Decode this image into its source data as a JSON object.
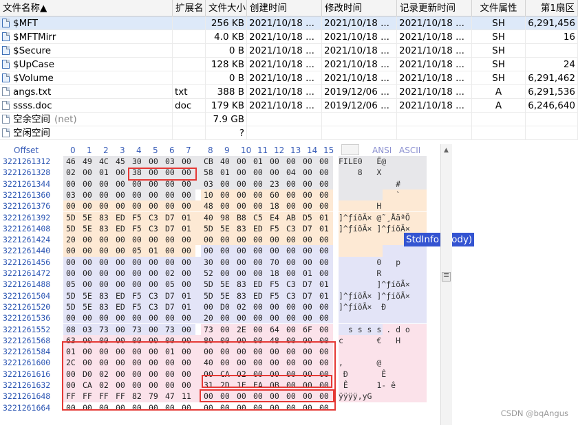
{
  "file_table": {
    "headers": {
      "name": "文件名称▲",
      "ext": "扩展名",
      "size": "文件大小",
      "ctime": "创建时间",
      "mtime": "修改时间",
      "rtime": "记录更新时间",
      "attr": "文件属性",
      "sector": "第1扇区"
    },
    "rows": [
      {
        "name": "$MFT",
        "ext": "",
        "size": "256 KB",
        "ctime": "2021/10/18  ...",
        "mtime": "2021/10/18  ...",
        "rtime": "2021/10/18  ...",
        "attr": "SH",
        "sector": "6,291,456",
        "selected": true
      },
      {
        "name": "$MFTMirr",
        "ext": "",
        "size": "4.0 KB",
        "ctime": "2021/10/18  ...",
        "mtime": "2021/10/18  ...",
        "rtime": "2021/10/18  ...",
        "attr": "SH",
        "sector": "16"
      },
      {
        "name": "$Secure",
        "ext": "",
        "size": "0 B",
        "ctime": "2021/10/18  ...",
        "mtime": "2021/10/18  ...",
        "rtime": "2021/10/18  ...",
        "attr": "SH",
        "sector": ""
      },
      {
        "name": "$UpCase",
        "ext": "",
        "size": "128 KB",
        "ctime": "2021/10/18  ...",
        "mtime": "2021/10/18  ...",
        "rtime": "2021/10/18  ...",
        "attr": "SH",
        "sector": "24"
      },
      {
        "name": "$Volume",
        "ext": "",
        "size": "0 B",
        "ctime": "2021/10/18  ...",
        "mtime": "2021/10/18  ...",
        "rtime": "2021/10/18  ...",
        "attr": "SH",
        "sector": "6,291,462"
      },
      {
        "name": "angs.txt",
        "ext": "txt",
        "size": "388 B",
        "ctime": "2021/10/18  ...",
        "mtime": "2019/12/06  ...",
        "rtime": "2021/10/18  ...",
        "attr": "A",
        "sector": "6,291,536"
      },
      {
        "name": "ssss.doc",
        "ext": "doc",
        "size": "179 KB",
        "ctime": "2021/10/18  ...",
        "mtime": "2019/12/06  ...",
        "rtime": "2021/10/18  ...",
        "attr": "A",
        "sector": "6,246,640"
      },
      {
        "name": "空余空间",
        "name_suffix": "(net)",
        "ext": "",
        "size": "7.9 GB",
        "ctime": "",
        "mtime": "",
        "rtime": "",
        "attr": "",
        "sector": ""
      },
      {
        "name": "空闲空间",
        "ext": "",
        "size": "?",
        "ctime": "",
        "mtime": "",
        "rtime": "",
        "attr": "",
        "sector": ""
      }
    ]
  },
  "hex_view": {
    "offset_label": "Offset",
    "columns": [
      "0",
      "1",
      "2",
      "3",
      "4",
      "5",
      "6",
      "7",
      "8",
      "9",
      "10",
      "11",
      "12",
      "13",
      "14",
      "15"
    ],
    "ansi_label": "ANSI",
    "ascii_label": "ASCII",
    "lines": [
      {
        "offset": "3221261312",
        "bytes": [
          "46",
          "49",
          "4C",
          "45",
          "30",
          "00",
          "03",
          "00",
          "CB",
          "40",
          "00",
          "01",
          "00",
          "00",
          "00",
          "00"
        ],
        "ascii": "FILE0   Ë@"
      },
      {
        "offset": "3221261328",
        "bytes": [
          "02",
          "00",
          "01",
          "00",
          "38",
          "00",
          "00",
          "00",
          "58",
          "01",
          "00",
          "00",
          "00",
          "04",
          "00",
          "00"
        ],
        "ascii": "    8   X"
      },
      {
        "offset": "3221261344",
        "bytes": [
          "00",
          "00",
          "00",
          "00",
          "00",
          "00",
          "00",
          "00",
          "03",
          "00",
          "00",
          "00",
          "23",
          "00",
          "00",
          "00"
        ],
        "ascii": "            #"
      },
      {
        "offset": "3221261360",
        "bytes": [
          "03",
          "00",
          "00",
          "00",
          "00",
          "00",
          "00",
          "00",
          "10",
          "00",
          "00",
          "00",
          "60",
          "00",
          "00",
          "00"
        ],
        "ascii": "            `"
      },
      {
        "offset": "3221261376",
        "bytes": [
          "00",
          "00",
          "00",
          "00",
          "00",
          "00",
          "00",
          "00",
          "48",
          "00",
          "00",
          "00",
          "18",
          "00",
          "00",
          "00"
        ],
        "ascii": "        H"
      },
      {
        "offset": "3221261392",
        "bytes": [
          "5D",
          "5E",
          "83",
          "ED",
          "F5",
          "C3",
          "D7",
          "01",
          "40",
          "98",
          "B8",
          "C5",
          "E4",
          "AB",
          "D5",
          "01"
        ],
        "ascii": "]^ƒíõÃ× @˜¸ÅäªÕ"
      },
      {
        "offset": "3221261408",
        "bytes": [
          "5D",
          "5E",
          "83",
          "ED",
          "F5",
          "C3",
          "D7",
          "01",
          "5D",
          "5E",
          "83",
          "ED",
          "F5",
          "C3",
          "D7",
          "01"
        ],
        "ascii": "]^ƒíõÃ× ]^ƒíõÃ×"
      },
      {
        "offset": "3221261424",
        "bytes": [
          "20",
          "00",
          "00",
          "00",
          "00",
          "00",
          "00",
          "00",
          "00",
          "00",
          "00",
          "00",
          "00",
          "00",
          "00",
          "00"
        ],
        "ascii": ""
      },
      {
        "offset": "3221261440",
        "bytes": [
          "00",
          "00",
          "00",
          "00",
          "05",
          "01",
          "00",
          "00",
          "00",
          "00",
          "00",
          "00",
          "00",
          "00",
          "00",
          "00"
        ],
        "ascii": ""
      },
      {
        "offset": "3221261456",
        "bytes": [
          "00",
          "00",
          "00",
          "00",
          "00",
          "00",
          "00",
          "00",
          "30",
          "00",
          "00",
          "00",
          "70",
          "00",
          "00",
          "00"
        ],
        "ascii": "        0   p"
      },
      {
        "offset": "3221261472",
        "bytes": [
          "00",
          "00",
          "00",
          "00",
          "00",
          "00",
          "02",
          "00",
          "52",
          "00",
          "00",
          "00",
          "18",
          "00",
          "01",
          "00"
        ],
        "ascii": "        R"
      },
      {
        "offset": "3221261488",
        "bytes": [
          "05",
          "00",
          "00",
          "00",
          "00",
          "00",
          "05",
          "00",
          "5D",
          "5E",
          "83",
          "ED",
          "F5",
          "C3",
          "D7",
          "01"
        ],
        "ascii": "        ]^ƒíõÃ×"
      },
      {
        "offset": "3221261504",
        "bytes": [
          "5D",
          "5E",
          "83",
          "ED",
          "F5",
          "C3",
          "D7",
          "01",
          "5D",
          "5E",
          "83",
          "ED",
          "F5",
          "C3",
          "D7",
          "01"
        ],
        "ascii": "]^ƒíõÃ× ]^ƒíõÃ×"
      },
      {
        "offset": "3221261520",
        "bytes": [
          "5D",
          "5E",
          "83",
          "ED",
          "F5",
          "C3",
          "D7",
          "01",
          "00",
          "D0",
          "02",
          "00",
          "00",
          "00",
          "00",
          "00"
        ],
        "ascii": "]^ƒíõÃ×  Ð"
      },
      {
        "offset": "3221261536",
        "bytes": [
          "00",
          "00",
          "00",
          "00",
          "00",
          "00",
          "00",
          "00",
          "20",
          "00",
          "00",
          "00",
          "00",
          "00",
          "00",
          "00"
        ],
        "ascii": ""
      },
      {
        "offset": "3221261552",
        "bytes": [
          "08",
          "03",
          "73",
          "00",
          "73",
          "00",
          "73",
          "00",
          "73",
          "00",
          "2E",
          "00",
          "64",
          "00",
          "6F",
          "00"
        ],
        "ascii": "  s s s s . d o"
      },
      {
        "offset": "3221261568",
        "bytes": [
          "63",
          "00",
          "00",
          "00",
          "00",
          "00",
          "00",
          "00",
          "80",
          "00",
          "00",
          "00",
          "48",
          "00",
          "00",
          "00"
        ],
        "ascii": "c       €   H"
      },
      {
        "offset": "3221261584",
        "bytes": [
          "01",
          "00",
          "00",
          "00",
          "00",
          "00",
          "01",
          "00",
          "00",
          "00",
          "00",
          "00",
          "00",
          "00",
          "00",
          "00"
        ],
        "ascii": ""
      },
      {
        "offset": "3221261600",
        "bytes": [
          "2C",
          "00",
          "00",
          "00",
          "00",
          "00",
          "00",
          "00",
          "40",
          "00",
          "00",
          "00",
          "00",
          "00",
          "00",
          "00"
        ],
        "ascii": ",       @"
      },
      {
        "offset": "3221261616",
        "bytes": [
          "00",
          "D0",
          "02",
          "00",
          "00",
          "00",
          "00",
          "00",
          "00",
          "CA",
          "02",
          "00",
          "00",
          "00",
          "00",
          "00"
        ],
        "ascii": " Ð       Ê"
      },
      {
        "offset": "3221261632",
        "bytes": [
          "00",
          "CA",
          "02",
          "00",
          "00",
          "00",
          "00",
          "00",
          "31",
          "2D",
          "1E",
          "EA",
          "0B",
          "00",
          "00",
          "00"
        ],
        "ascii": " Ê      1- ê"
      },
      {
        "offset": "3221261648",
        "bytes": [
          "FF",
          "FF",
          "FF",
          "FF",
          "82",
          "79",
          "47",
          "11",
          "00",
          "00",
          "00",
          "00",
          "00",
          "00",
          "00",
          "00"
        ],
        "ascii": "ÿÿÿÿ‚yG"
      },
      {
        "offset": "3221261664",
        "bytes": [
          "00",
          "00",
          "00",
          "00",
          "00",
          "00",
          "00",
          "00",
          "00",
          "00",
          "00",
          "00",
          "00",
          "00",
          "00",
          "00"
        ],
        "ascii": ""
      }
    ],
    "tooltip": "StdInfo (body)"
  },
  "colors": {
    "offset_blue": "#2b55b3",
    "selection": "#dde9f9",
    "tooltip_bg": "#3454d1",
    "highlight_red": "#e53935",
    "band_grey": "#e7e7ea",
    "band_orange": "#fde9d4",
    "band_blue": "#e3e4f7",
    "band_pink": "#fbe2ea"
  },
  "watermark": "CSDN @bqAngus"
}
